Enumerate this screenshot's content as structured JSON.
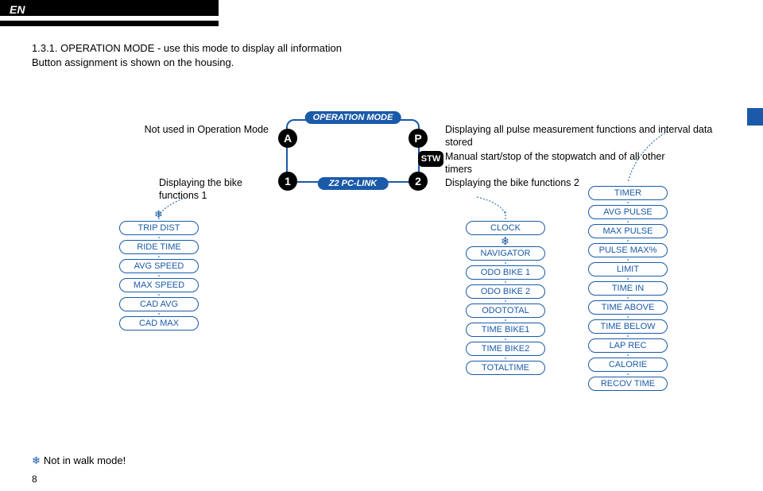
{
  "lang": "EN",
  "section_number": "1.3.1.",
  "section_title_line1": "OPERATION MODE - use this mode to display all information",
  "section_title_line2": "Button assignment is shown on the housing.",
  "op_mode": "OPERATION MODE",
  "pc_link": "Z2 PC-LINK",
  "buttons": {
    "a": "A",
    "p": "P",
    "one": "1",
    "two": "2",
    "stw": "STW"
  },
  "labels": {
    "a": "Not used in Operation Mode",
    "p": "Displaying all pulse measurement functions and interval data stored",
    "stw": "Manual start/stop of the stopwatch and of all other timers",
    "one": "Displaying the bike functions 1",
    "two": "Displaying the bike functions 2"
  },
  "col1": [
    "TRIP DIST",
    "RIDE TIME",
    "AVG SPEED",
    "MAX SPEED",
    "CAD AVG",
    "CAD MAX"
  ],
  "col2": [
    "CLOCK",
    "NAVIGATOR",
    "ODO BIKE 1",
    "ODO BIKE 2",
    "ODOTOTAL",
    "TIME BIKE1",
    "TIME BIKE2",
    "TOTALTIME"
  ],
  "col3": [
    "TIMER",
    "AVG PULSE",
    "MAX PULSE",
    "PULSE MAX%",
    "LIMIT",
    "TIME IN",
    "TIME ABOVE",
    "TIME BELOW",
    "LAP REC",
    "CALORIE",
    "RECOV TIME"
  ],
  "footnote": "Not in walk mode!",
  "page": "8"
}
